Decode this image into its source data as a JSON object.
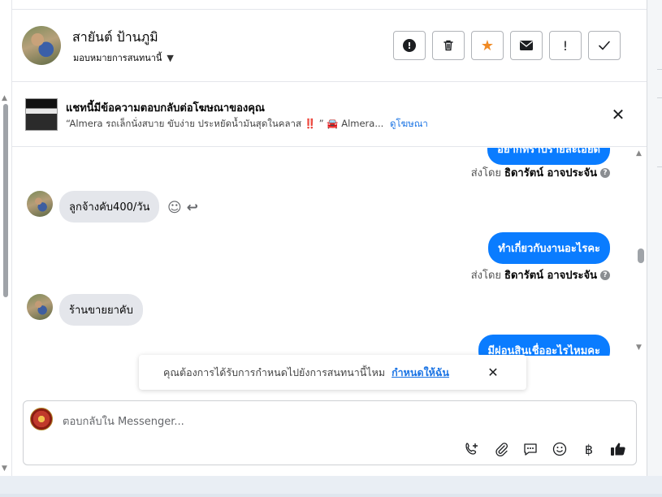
{
  "header": {
    "contact_name": "สายันต์ ป้านภูมิ",
    "assign_label": "มอบหมายการสนทนานี้",
    "actions": [
      {
        "name": "spam-button",
        "icon": "exclamation-circle-icon",
        "glyph": "●"
      },
      {
        "name": "delete-button",
        "icon": "trash-icon",
        "glyph": "🗑"
      },
      {
        "name": "star-button",
        "icon": "star-icon",
        "glyph": "★"
      },
      {
        "name": "mark-unread-button",
        "icon": "envelope-icon",
        "glyph": "✉"
      },
      {
        "name": "follow-up-button",
        "icon": "exclamation-icon",
        "glyph": "!"
      },
      {
        "name": "done-button",
        "icon": "check-icon",
        "glyph": "✓"
      }
    ]
  },
  "ad_banner": {
    "title": "แชทนี้มีข้อความตอบกลับต่อโฆษณาของคุณ",
    "subtitle": "“Almera รถเล็กนั่งสบาย ขับง่าย ประหยัดน้ำมันสุดในคลาส ‼️ ” 🚘 Almera...",
    "link": "ดูโฆษณา",
    "close_glyph": "✕"
  },
  "messages": {
    "partial_top_text": "อยากทราบรายละเอียด",
    "sent_by_prefix": "ส่งโดย",
    "sender_name": "ธิดารัตน์ อาจประจัน",
    "incoming_1": "ลูกจ้างคับ400/วัน",
    "outgoing_1": "ทำเกี่ยวกับงานอะไรคะ",
    "incoming_2": "ร้านขายยาคับ",
    "outgoing_2": "มีผ่อนสินเชื่ออะไรไหมคะ",
    "react_glyph": "☺",
    "reply_glyph": "↩",
    "help_glyph": "?"
  },
  "notice": {
    "text": "คุณต้องการได้รับการกำหนดไปยังการสนทนานี้ไหม",
    "link": "กำหนดให้ฉัน",
    "close_glyph": "✕"
  },
  "composer": {
    "placeholder": "ตอบกลับใน Messenger...",
    "tools": [
      {
        "name": "call-add-icon",
        "glyph": "✆"
      },
      {
        "name": "attach-icon",
        "glyph": "📎"
      },
      {
        "name": "saved-replies-icon",
        "glyph": "💬"
      },
      {
        "name": "emoji-icon",
        "glyph": "☺"
      },
      {
        "name": "payment-icon",
        "glyph": "฿"
      },
      {
        "name": "thumbs-up-icon",
        "glyph": "👍"
      }
    ]
  },
  "colors": {
    "accent_blue": "#0a7cff",
    "link_blue": "#1b74e4",
    "star_orange": "#f08a24",
    "incoming_bubble": "#e4e6eb"
  }
}
